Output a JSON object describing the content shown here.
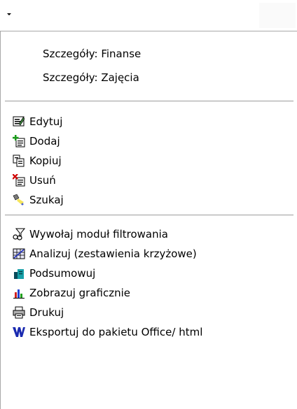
{
  "menu": {
    "details": [
      {
        "label": "Szczegóły: Finanse"
      },
      {
        "label": "Szczegóły: Zajęcia"
      }
    ],
    "record_actions": [
      {
        "label": "Edytuj",
        "icon": "edit-record-icon"
      },
      {
        "label": "Dodaj",
        "icon": "add-record-icon"
      },
      {
        "label": "Kopiuj",
        "icon": "copy-record-icon"
      },
      {
        "label": "Usuń",
        "icon": "delete-record-icon"
      },
      {
        "label": "Szukaj",
        "icon": "search-flashlight-icon"
      }
    ],
    "tools": [
      {
        "label": "Wywołaj moduł filtrowania",
        "icon": "filter-funnel-icon"
      },
      {
        "label": "Analizuj (zestawienia krzyżowe)",
        "icon": "crosstab-analysis-icon"
      },
      {
        "label": "Podsumowuj",
        "icon": "summary-icon"
      },
      {
        "label": "Zobrazuj graficznie",
        "icon": "bar-chart-icon"
      },
      {
        "label": "Drukuj",
        "icon": "printer-icon"
      },
      {
        "label": "Eksportuj do pakietu Office/ html",
        "icon": "word-export-icon"
      }
    ]
  },
  "colors": {
    "separator": "#9c9c9c",
    "border": "#a8a8a8"
  }
}
